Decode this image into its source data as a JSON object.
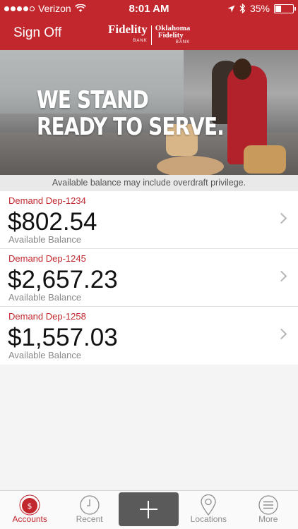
{
  "status_bar": {
    "carrier": "Verizon",
    "time": "8:01 AM",
    "battery_percent": "35%",
    "battery_level": 0.35,
    "signal_bars_filled": 4,
    "signal_bars_total": 5
  },
  "header": {
    "sign_off_label": "Sign Off",
    "logo_primary": "Fidelity",
    "logo_primary_sub": "BANK",
    "logo_secondary_line1": "Oklahoma",
    "logo_secondary_line2": "Fidelity",
    "logo_secondary_sub": "BANK",
    "brand_color": "#c1272d"
  },
  "hero": {
    "line1": "WE STAND",
    "line2": "READY TO SERVE."
  },
  "notice": {
    "text": "Available balance may include overdraft privilege."
  },
  "accounts": [
    {
      "name": "Demand Dep-1234",
      "amount": "$802.54",
      "label": "Available Balance"
    },
    {
      "name": "Demand Dep-1245",
      "amount": "$2,657.23",
      "label": "Available Balance"
    },
    {
      "name": "Demand Dep-1258",
      "amount": "$1,557.03",
      "label": "Available Balance"
    }
  ],
  "tabbar": {
    "items": [
      {
        "label": "Accounts",
        "icon": "dollar-coin-icon",
        "active": true
      },
      {
        "label": "Recent",
        "icon": "clock-icon",
        "active": false
      },
      {
        "label": "",
        "icon": "plus-icon",
        "active": false
      },
      {
        "label": "Locations",
        "icon": "map-pin-icon",
        "active": false
      },
      {
        "label": "More",
        "icon": "menu-icon",
        "active": false
      }
    ],
    "active_color": "#c1272d"
  }
}
